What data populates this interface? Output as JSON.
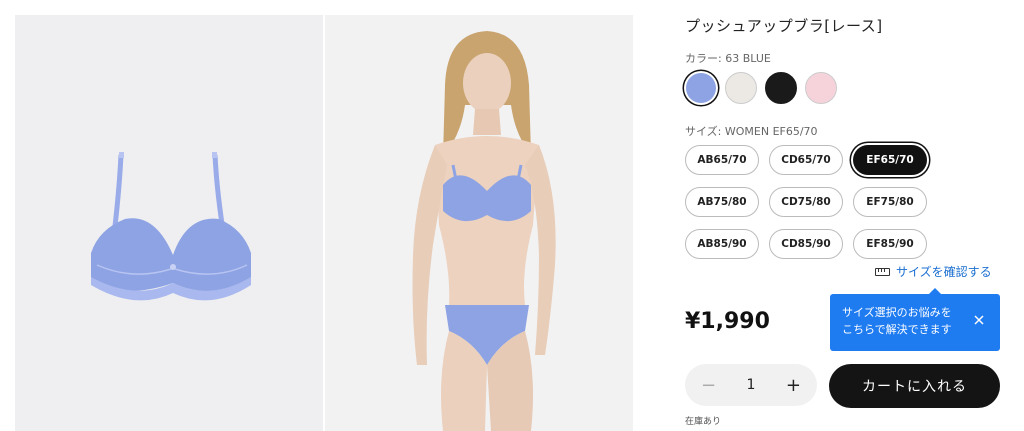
{
  "product": {
    "title": "プッシュアップブラ[レース]",
    "color_label": "カラー: 63 BLUE",
    "colors": [
      {
        "name": "BLUE",
        "hex": "#8ea3e3",
        "selected": true
      },
      {
        "name": "OFF WHITE",
        "hex": "#ece9e4",
        "selected": false
      },
      {
        "name": "BLACK",
        "hex": "#1a1a1a",
        "selected": false
      },
      {
        "name": "PINK",
        "hex": "#f6d3db",
        "selected": false
      }
    ],
    "size_label": "サイズ: WOMEN EF65/70",
    "sizes": [
      "AB65/70",
      "CD65/70",
      "EF65/70",
      "AB75/80",
      "CD75/80",
      "EF75/80",
      "AB85/90",
      "CD85/90",
      "EF85/90"
    ],
    "selected_size": "EF65/70",
    "size_guide_label": "サイズを確認する",
    "price": "¥1,990",
    "quantity": "1",
    "qty_minus": "−",
    "qty_plus": "+",
    "add_to_cart_label": "カートに入れる",
    "stock_label": "在庫あり"
  },
  "tooltip": {
    "line1": "サイズ選択のお悩みを",
    "line2": "こちらで解決できます"
  },
  "colors": {
    "accent_blue": "#1e7bf0",
    "product_blue": "#8ea3e3",
    "dark": "#141414"
  }
}
